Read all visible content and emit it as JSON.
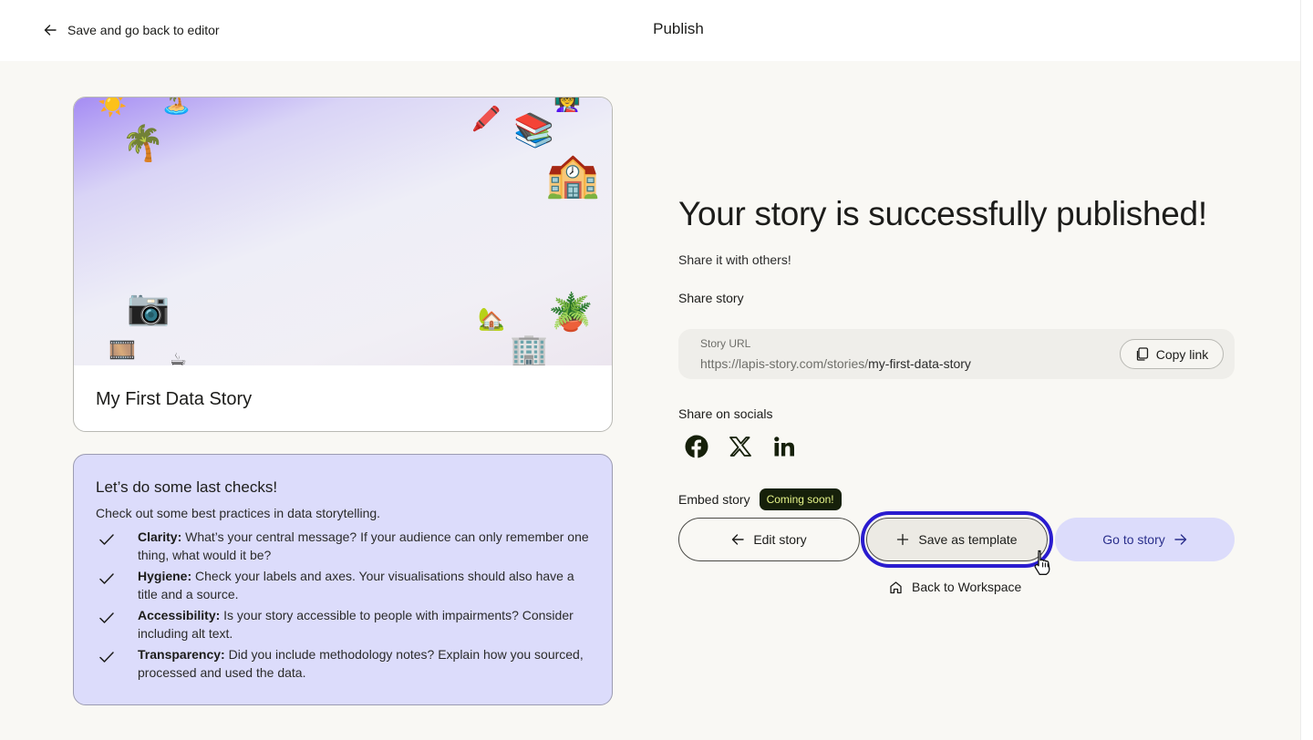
{
  "header": {
    "back_label": "Save and go back to editor",
    "title": "Publish"
  },
  "story_card": {
    "title": "My First Data Story",
    "cover_emojis": [
      "☀️",
      "🏝️",
      "🌴",
      "🖍️",
      "👩‍🏫",
      "📚",
      "🏫",
      "📷",
      "🏡",
      "🪴",
      "🎞️",
      "☕",
      "🏢"
    ]
  },
  "checks": {
    "title": "Let’s do some last checks!",
    "subtitle": "Check out some best practices in data storytelling.",
    "items": [
      {
        "label": "Clarity:",
        "text": " What’s your central message? If your audience can only remember one thing, what would it be?"
      },
      {
        "label": "Hygiene:",
        "text": " Check your labels and axes. Your visualisations should also have a title and a source."
      },
      {
        "label": "Accessibility:",
        "text": " Is your story accessible to people with impairments? Consider including alt text."
      },
      {
        "label": "Transparency:",
        "text": " Did you include methodology notes? Explain how you sourced, processed and used the data."
      }
    ]
  },
  "main": {
    "headline": "Your story is successfully published!",
    "share_subtitle": "Share it with others!",
    "share_story_label": "Share story",
    "url_label": "Story URL",
    "url_base": "https://lapis-story.com/stories/",
    "url_slug": "my-first-data-story",
    "copy_link_label": "Copy link",
    "share_socials_label": "Share on socials",
    "socials": [
      {
        "name": "facebook-icon"
      },
      {
        "name": "x-icon"
      },
      {
        "name": "linkedin-icon"
      }
    ],
    "embed_label": "Embed story",
    "embed_badge": "Coming soon!",
    "edit_story_label": "Edit story",
    "save_template_label": "Save as template",
    "go_to_story_label": "Go to story",
    "back_workspace_label": "Back to Workspace"
  },
  "colors": {
    "background": "#f9f8f4",
    "checks_bg": "#dcdcfb",
    "focus_ring": "#2a1ccf",
    "badge_bg": "#16200a",
    "badge_text": "#e7f58a",
    "go_to_story_text": "#2a2f8c"
  }
}
